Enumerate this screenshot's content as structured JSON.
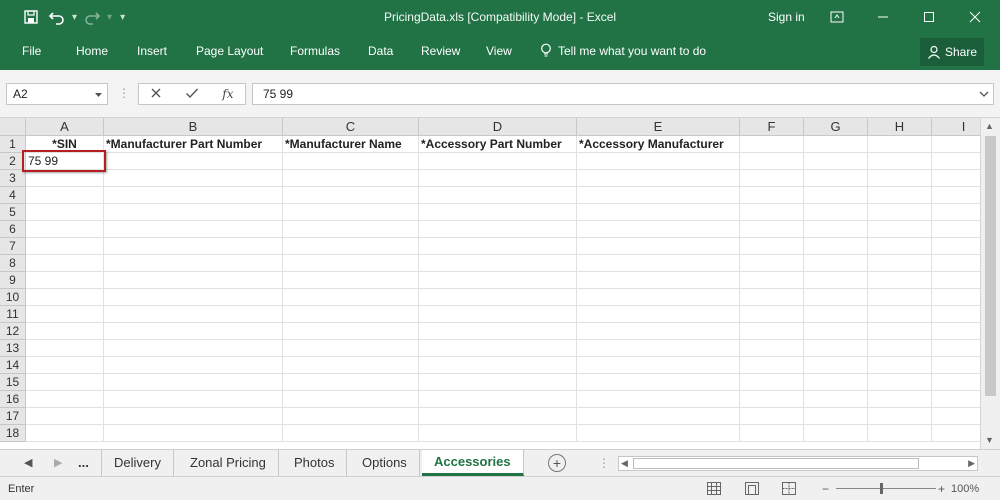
{
  "window": {
    "title": "PricingData.xls  [Compatibility Mode] - Excel",
    "signin": "Sign in"
  },
  "ribbon": {
    "tabs": [
      "File",
      "Home",
      "Insert",
      "Page Layout",
      "Formulas",
      "Data",
      "Review",
      "View"
    ],
    "tell_me": "Tell me what you want to do",
    "share": "Share"
  },
  "formula_bar": {
    "name_box": "A2",
    "fx": "fx",
    "formula": "75 99"
  },
  "grid": {
    "columns": [
      "A",
      "B",
      "C",
      "D",
      "E",
      "F",
      "G",
      "H",
      "I"
    ],
    "rows": [
      "1",
      "2",
      "3",
      "4",
      "5",
      "6",
      "7",
      "8",
      "9",
      "10",
      "11",
      "12",
      "13",
      "14",
      "15",
      "16",
      "17",
      "18"
    ],
    "headers": {
      "A": "*SIN",
      "B": "*Manufacturer Part Number",
      "C": "*Manufacturer Name",
      "D": "*Accessory Part Number",
      "E": "*Accessory Manufacturer"
    },
    "A2": "75 99",
    "active_cell": "A2"
  },
  "sheets": {
    "ellipsis": "...",
    "tabs": [
      "Delivery",
      "Zonal Pricing",
      "Photos",
      "Options",
      "Accessories"
    ],
    "active": "Accessories",
    "add": "+"
  },
  "status": {
    "mode": "Enter",
    "zoom": "100%"
  },
  "colors": {
    "excel_green": "#217346",
    "active_cell_border": "#b51f24"
  }
}
